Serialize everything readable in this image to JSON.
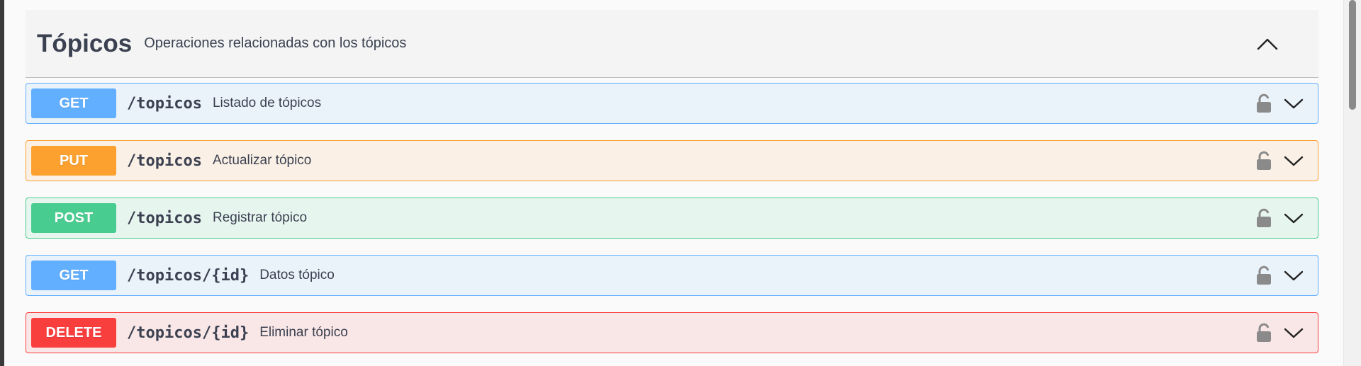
{
  "section": {
    "title": "Tópicos",
    "description": "Operaciones relacionadas con los tópicos"
  },
  "icons": {
    "collapse": "chevron-up-icon",
    "lock": "unlocked-padlock-icon",
    "expand": "chevron-down-icon"
  },
  "colors": {
    "get": "#61affe",
    "put": "#fca130",
    "post": "#49cc90",
    "delete": "#f93e3e"
  },
  "operations": [
    {
      "method": "GET",
      "path": "/topicos",
      "summary": "Listado de tópicos"
    },
    {
      "method": "PUT",
      "path": "/topicos",
      "summary": "Actualizar tópico"
    },
    {
      "method": "POST",
      "path": "/topicos",
      "summary": "Registrar tópico"
    },
    {
      "method": "GET",
      "path": "/topicos/{id}",
      "summary": "Datos tópico"
    },
    {
      "method": "DELETE",
      "path": "/topicos/{id}",
      "summary": "Eliminar tópico"
    }
  ]
}
